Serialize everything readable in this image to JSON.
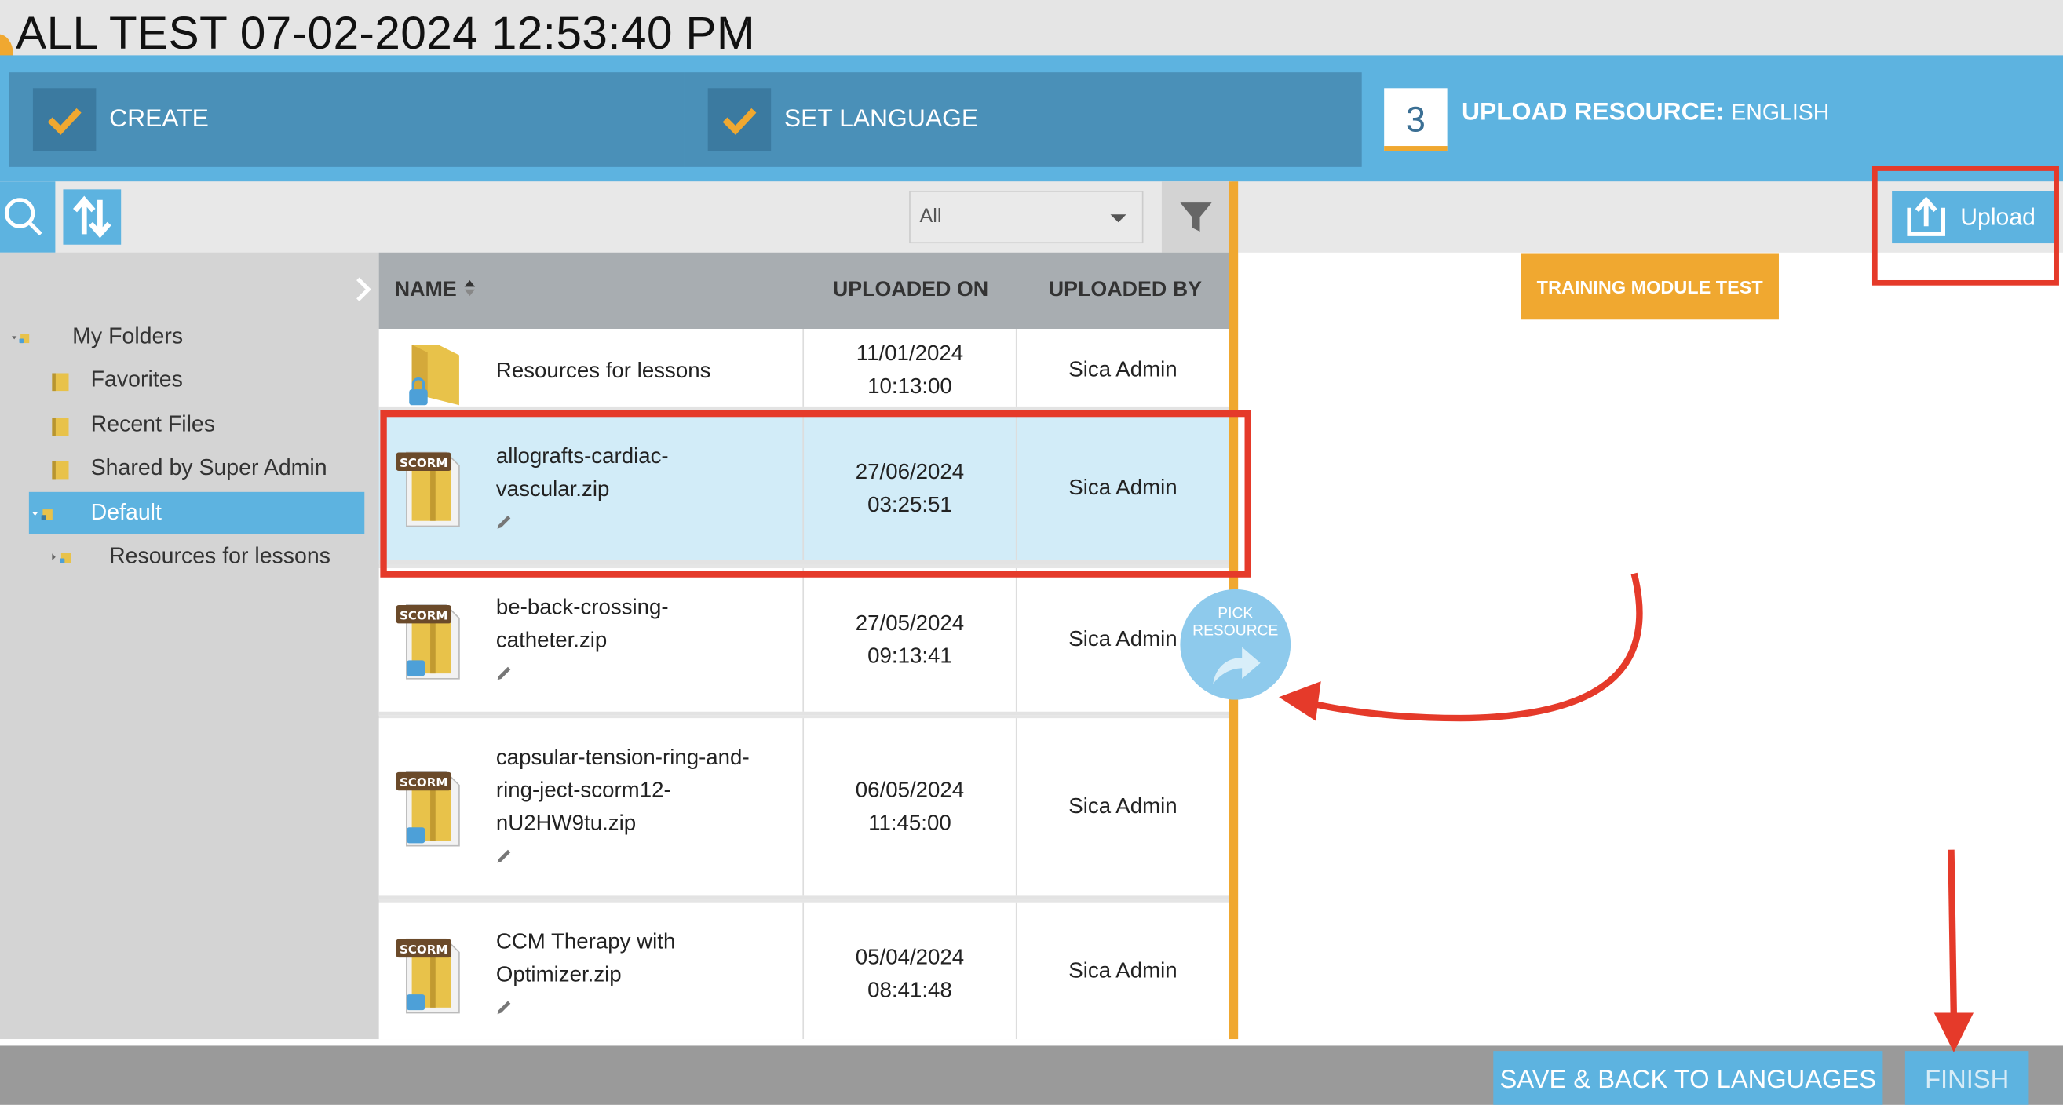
{
  "window": {
    "title": "ALL TEST 07-02-2024 12:53:40 PM"
  },
  "steps": [
    {
      "label": "CREATE",
      "state": "complete"
    },
    {
      "label": "SET LANGUAGE",
      "state": "complete"
    },
    {
      "number": "3",
      "label": "UPLOAD RESOURCE",
      "separator": ":",
      "language": "ENGLISH",
      "state": "current"
    }
  ],
  "toolbar": {
    "search_icon": "search-icon",
    "sort_icon": "sort-arrows-icon",
    "filter_select": {
      "value": "All"
    },
    "filter_icon": "funnel-icon",
    "upload_label": "Upload",
    "upload_icon": "upload-icon"
  },
  "sidebar": {
    "toggle_icon": "chevron-right-icon",
    "tree": [
      {
        "label": "My Folders",
        "level": 0,
        "expanded": true
      },
      {
        "label": "Favorites",
        "level": 1
      },
      {
        "label": "Recent Files",
        "level": 1
      },
      {
        "label": "Shared by Super Admin",
        "level": 1
      },
      {
        "label": "Default",
        "level": 1,
        "expanded": true,
        "selected": true
      },
      {
        "label": "Resources for lessons",
        "level": 2,
        "collapsed": true
      }
    ]
  },
  "table": {
    "columns": {
      "name": "NAME",
      "uploaded_on": "UPLOADED ON",
      "uploaded_by": "UPLOADED BY"
    },
    "sort_icon": "sort-caret-icon",
    "rows": [
      {
        "name": "Resources for lessons",
        "date": "11/01/2024",
        "time": "10:13:00",
        "by": "Sica Admin",
        "type": "folder"
      },
      {
        "name": "allografts-cardiac-vascular.zip",
        "name_lines": [
          "allografts-cardiac-",
          "vascular.zip"
        ],
        "date": "27/06/2024",
        "time": "03:25:51",
        "by": "Sica Admin",
        "type": "scorm",
        "selected": true
      },
      {
        "name": "be-back-crossing-catheter.zip",
        "name_lines": [
          "be-back-crossing-",
          "catheter.zip"
        ],
        "date": "27/05/2024",
        "time": "09:13:41",
        "by": "Sica Admin",
        "type": "scorm"
      },
      {
        "name": "capsular-tension-ring-and-ring-ject-scorm12-nU2HW9tu.zip",
        "name_lines": [
          "capsular-tension-ring-and-",
          "ring-ject-scorm12-",
          "nU2HW9tu.zip"
        ],
        "date": "06/05/2024",
        "time": "11:45:00",
        "by": "Sica Admin",
        "type": "scorm"
      },
      {
        "name": "CCM Therapy with Optimizer.zip",
        "name_lines": [
          "CCM Therapy with",
          "Optimizer.zip"
        ],
        "date": "05/04/2024",
        "time": "08:41:48",
        "by": "Sica Admin",
        "type": "scorm"
      }
    ],
    "scorm_badge": "SCORM"
  },
  "right_panel": {
    "module_label": "TRAINING MODULE TEST"
  },
  "pick_resource": {
    "line1": "PICK",
    "line2": "RESOURCE"
  },
  "footer": {
    "save_back_label": "SAVE & BACK TO LANGUAGES",
    "finish_label": "FINISH"
  },
  "colors": {
    "accent_blue": "#5db3e0",
    "step_blue": "#4a90b8",
    "orange": "#f0a830",
    "annotation_red": "#e53a2a"
  }
}
